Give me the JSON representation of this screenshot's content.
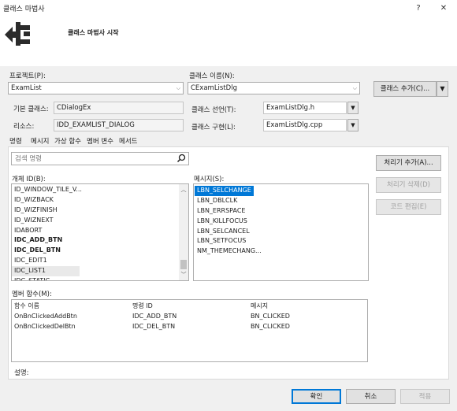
{
  "window": {
    "title": "클래스 마법사",
    "help_label": "?",
    "close_label": "✕",
    "header_title": "클래스 마법사 시작",
    "logo_icon": "class-wizard-logo"
  },
  "project": {
    "label": "프로젝트(P):",
    "value": "ExamList"
  },
  "class_name": {
    "label": "클래스 이름(N):",
    "value": "CExamListDlg"
  },
  "add_class_button": "클래스 추가(C)...",
  "base_class": {
    "label": "기본 클래스:",
    "value": "CDialogEx"
  },
  "resource": {
    "label": "리소스:",
    "value": "IDD_EXAMLIST_DIALOG"
  },
  "class_decl": {
    "label": "클래스 선언(T):",
    "value": "ExamListDlg.h"
  },
  "class_impl": {
    "label": "클래스 구현(L):",
    "value": "ExamListDlg.cpp"
  },
  "tabs": [
    "명령",
    "메시지",
    "가상 함수",
    "멤버 변수",
    "메서드"
  ],
  "search": {
    "placeholder": "검색 명령"
  },
  "objects": {
    "label": "개체 ID(B):",
    "items": [
      {
        "text": "ID_WINDOW_TILE_V...",
        "bold": false
      },
      {
        "text": "ID_WIZBACK",
        "bold": false
      },
      {
        "text": "ID_WIZFINISH",
        "bold": false
      },
      {
        "text": "ID_WIZNEXT",
        "bold": false
      },
      {
        "text": "IDABORT",
        "bold": false
      },
      {
        "text": "IDC_ADD_BTN",
        "bold": true
      },
      {
        "text": "IDC_DEL_BTN",
        "bold": true
      },
      {
        "text": "IDC_EDIT1",
        "bold": false
      },
      {
        "text": "IDC_LIST1",
        "bold": false
      },
      {
        "text": "IDC_STATIC",
        "bold": false
      }
    ],
    "selected_index": 8
  },
  "messages": {
    "label": "메시지(S):",
    "items": [
      "LBN_SELCHANGE",
      "LBN_DBLCLK",
      "LBN_ERRSPACE",
      "LBN_KILLFOCUS",
      "LBN_SELCANCEL",
      "LBN_SETFOCUS",
      "NM_THEMECHANG..."
    ],
    "selected_index": 0
  },
  "handler_buttons": {
    "add": "처리기 추가(A)...",
    "delete": "처리기 삭제(D)",
    "edit": "코드 편집(E)"
  },
  "member_functions": {
    "label": "멤버 함수(M):",
    "columns": [
      "함수 이름",
      "명령 ID",
      "메시지"
    ],
    "rows": [
      [
        "OnBnClickedAddBtn",
        "IDC_ADD_BTN",
        "BN_CLICKED"
      ],
      [
        "OnBnClickedDelBtn",
        "IDC_DEL_BTN",
        "BN_CLICKED"
      ]
    ]
  },
  "description_label": "설명:",
  "footer": {
    "ok": "확인",
    "cancel": "취소",
    "apply": "적용"
  },
  "colors": {
    "accent": "#0078d7",
    "selection": "#0078d7"
  }
}
